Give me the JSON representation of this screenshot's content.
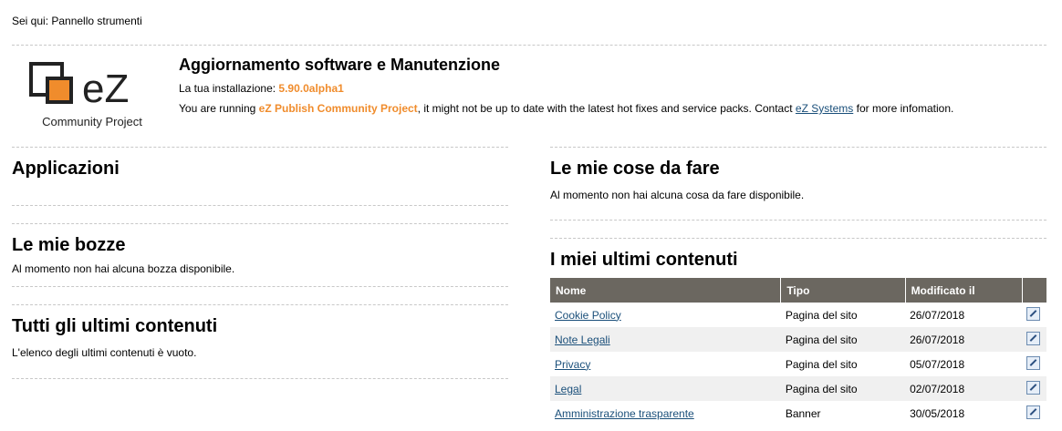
{
  "breadcrumb": "Sei qui: Pannello strumenti",
  "logo": {
    "mark": "eZ",
    "caption": "Community Project"
  },
  "update": {
    "title": "Aggiornamento software e Manutenzione",
    "install_label": "La tua installazione:",
    "version": "5.90.0alpha1",
    "running_prefix": "You are running",
    "product": "eZ Publish Community Project",
    "running_mid": ", it might not be up to date with the latest hot fixes and service packs. Contact",
    "contact_link": "eZ Systems",
    "running_suffix": "for more infomation."
  },
  "sections": {
    "applications": {
      "title": "Applicazioni"
    },
    "drafts": {
      "title": "Le mie bozze",
      "empty": "Al momento non hai alcuna bozza disponibile."
    },
    "all_latest": {
      "title": "Tutti gli ultimi contenuti",
      "empty": "L'elenco degli ultimi contenuti è vuoto."
    },
    "todo": {
      "title": "Le mie cose da fare",
      "empty": "Al momento non hai alcuna cosa da fare disponibile."
    },
    "my_latest": {
      "title": "I miei ultimi contenuti",
      "columns": [
        "Nome",
        "Tipo",
        "Modificato il",
        ""
      ],
      "rows": [
        {
          "name": "Cookie Policy",
          "type": "Pagina del sito",
          "modified": "26/07/2018"
        },
        {
          "name": "Note Legali",
          "type": "Pagina del sito",
          "modified": "26/07/2018"
        },
        {
          "name": "Privacy",
          "type": "Pagina del sito",
          "modified": "05/07/2018"
        },
        {
          "name": "Legal",
          "type": "Pagina del sito",
          "modified": "02/07/2018"
        },
        {
          "name": "Amministrazione trasparente",
          "type": "Banner",
          "modified": "30/05/2018"
        }
      ]
    }
  },
  "colors": {
    "accent": "#f08c2c",
    "header_bg": "#6b6760",
    "link": "#1a4f7a"
  },
  "icons": {
    "edit": "edit-icon"
  }
}
